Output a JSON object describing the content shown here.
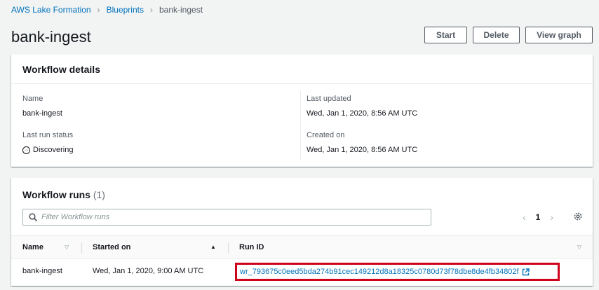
{
  "breadcrumb": {
    "root": "AWS Lake Formation",
    "parent": "Blueprints",
    "current": "bank-ingest"
  },
  "page": {
    "title": "bank-ingest"
  },
  "actions": {
    "start": "Start",
    "delete": "Delete",
    "view_graph": "View graph"
  },
  "details": {
    "title": "Workflow details",
    "name_label": "Name",
    "name_value": "bank-ingest",
    "last_run_status_label": "Last run status",
    "last_run_status_value": "Discovering",
    "last_updated_label": "Last updated",
    "last_updated_value": "Wed, Jan 1, 2020, 8:56 AM UTC",
    "created_on_label": "Created on",
    "created_on_value": "Wed, Jan 1, 2020, 8:56 AM UTC"
  },
  "runs": {
    "title": "Workflow runs",
    "count": "(1)",
    "search_placeholder": "Filter Workflow runs",
    "page_number": "1",
    "columns": {
      "name": "Name",
      "started_on": "Started on",
      "run_id": "Run ID"
    },
    "rows": [
      {
        "name": "bank-ingest",
        "started_on": "Wed, Jan 1, 2020, 9:00 AM UTC",
        "run_id": "wr_793675c0eed5bda274b91cec149212d8a18325c0780d73f78dbe8de4fb34802f"
      }
    ]
  },
  "colors": {
    "link": "#0073bb",
    "highlight_border": "#d0021b",
    "background": "#f2f3f3"
  },
  "icons": [
    "chevron-right-icon",
    "status-in-progress-icon",
    "search-icon",
    "chevron-left-icon",
    "gear-icon",
    "sort-down-icon",
    "sort-up-icon",
    "external-link-icon"
  ]
}
